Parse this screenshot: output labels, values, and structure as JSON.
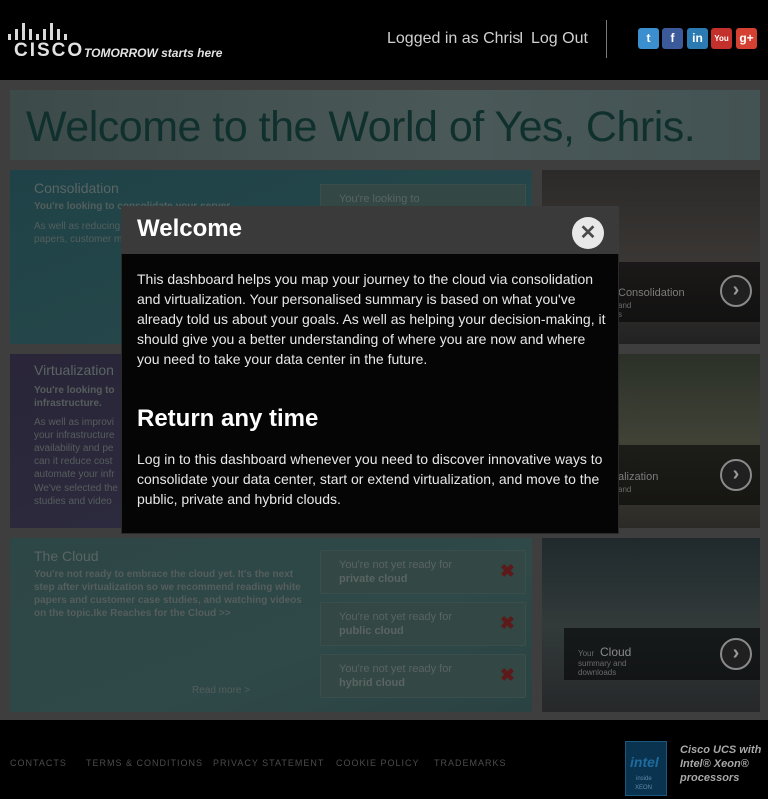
{
  "header": {
    "brand": "CISCO",
    "tagline": "TOMORROW starts here",
    "logged_in": "Logged in as Chris",
    "separator": "I",
    "logout": "Log Out",
    "social": [
      {
        "name": "twitter-icon",
        "glyph": "t",
        "color": "#3b8fce"
      },
      {
        "name": "facebook-icon",
        "glyph": "f",
        "color": "#3b5a9a"
      },
      {
        "name": "linkedin-icon",
        "glyph": "in",
        "color": "#2b7bb2"
      },
      {
        "name": "youtube-icon",
        "glyph": "You",
        "color": "#c4302b"
      },
      {
        "name": "googleplus-icon",
        "glyph": "g+",
        "color": "#d44132"
      }
    ]
  },
  "banner": {
    "title": "Welcome to the World of Yes, Chris."
  },
  "panels": {
    "consolidation": {
      "title": "Consolidation",
      "lead": "You're looking to consolidate your server",
      "body": "As well as reducing expenditure, consol towards the cloud papers, customer map your journey.",
      "card_prefix": "You're looking to"
    },
    "virtualization": {
      "title": "Virtualization",
      "lead": "You're looking to infrastructure.",
      "body": "As well as improvi your infrastructure availability and pe can it reduce cost automate your infr",
      "body2": "We've selected the studies and video"
    },
    "cloud": {
      "title": "The Cloud",
      "lead": "You're not ready to embrace the cloud yet. It's the next step after virtualization so we recommend reading white papers and customer case studies, and watching videos on the topic.Ike Reaches for the Cloud >>",
      "readmore": "Read more >",
      "cards": [
        {
          "prefix": "You're not yet ready for",
          "option": "private cloud",
          "mark": "✖"
        },
        {
          "prefix": "You're not yet ready for",
          "option": "public cloud",
          "mark": "✖"
        },
        {
          "prefix": "You're not yet ready for",
          "option": "hybrid cloud",
          "mark": "✖"
        }
      ]
    }
  },
  "photos": {
    "p1": {
      "label": "Consolidation",
      "sub1": "and",
      "sub2": "s"
    },
    "p2": {
      "label": "alization",
      "sub1": "and",
      "sub2": ""
    },
    "p3": {
      "small": "Your",
      "label": "Cloud",
      "sub1": "summary and",
      "sub2": "downloads"
    }
  },
  "modal": {
    "title": "Welcome",
    "close": "✕",
    "intro": "This dashboard helps you map your journey to the cloud via consolidation and virtualization. Your personalised summary is based on what you've already told us about your goals. As well as helping your decision-making, it should give you a better understanding of where you are now and where you need to take your data center in the future.",
    "subtitle": "Return any time",
    "outro": "Log in to this dashboard whenever you need to discover innovative ways to consolidate your data center, start or extend virtualization, and move to the public, private and hybrid clouds."
  },
  "footer": {
    "links": [
      "CONTACTS",
      "TERMS & CONDITIONS",
      "PRIVACY STATEMENT",
      "COOKIE POLICY",
      "TRADEMARKS"
    ],
    "intel_word": "intel",
    "intel_inside": "inside",
    "intel_xeon": "XEON",
    "intel_caption": "Cisco UCS with Intel® Xeon® processors"
  }
}
